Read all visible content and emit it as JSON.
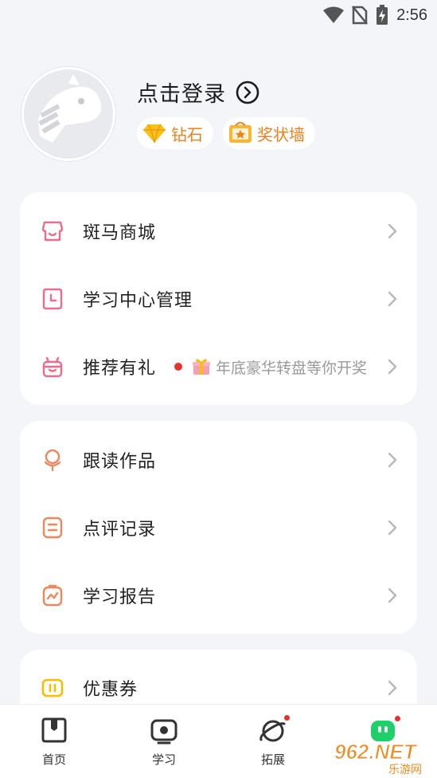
{
  "status_bar": {
    "time": "2:56"
  },
  "profile": {
    "login_label": "点击登录",
    "badges": [
      {
        "label": "钻石",
        "icon": "diamond-icon"
      },
      {
        "label": "奖状墙",
        "icon": "certificate-icon"
      }
    ]
  },
  "menu_group_1": [
    {
      "label": "斑马商城",
      "icon": "store-icon"
    },
    {
      "label": "学习中心管理",
      "icon": "clock-icon"
    },
    {
      "label": "推荐有礼",
      "icon": "gift-icon",
      "promo": "年底豪华转盘等你开奖"
    }
  ],
  "menu_group_2": [
    {
      "label": "跟读作品",
      "icon": "microphone-icon"
    },
    {
      "label": "点评记录",
      "icon": "comment-record-icon"
    },
    {
      "label": "学习报告",
      "icon": "report-icon"
    }
  ],
  "menu_group_3": [
    {
      "label": "优惠券",
      "icon": "coupon-icon"
    }
  ],
  "bottom_nav": [
    {
      "label": "首页",
      "icon": "home-book-icon"
    },
    {
      "label": "学习",
      "icon": "study-play-icon"
    },
    {
      "label": "拓展",
      "icon": "planet-icon"
    },
    {
      "label": "",
      "icon": "mine-robot-icon"
    }
  ],
  "watermark": {
    "text": "962.NET",
    "subtext": "乐游网"
  },
  "colors": {
    "accent_orange": "#f07f19",
    "icon_pink": "#ef6b8a",
    "icon_orange": "#f0875a",
    "icon_yellow": "#f5c000",
    "mine_green": "#1fcf6a",
    "red_dot": "#e8322d"
  }
}
